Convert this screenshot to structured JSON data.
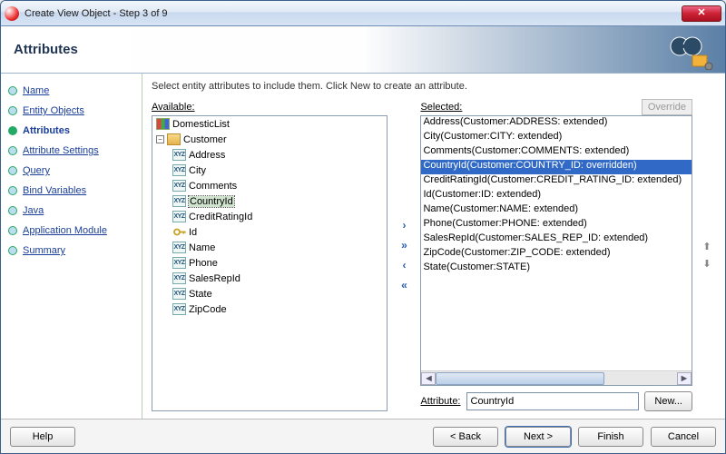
{
  "window": {
    "title": "Create View Object - Step 3 of 9",
    "close_glyph": "✕"
  },
  "banner": {
    "heading": "Attributes"
  },
  "steps": [
    {
      "label": "Name"
    },
    {
      "label": "Entity Objects"
    },
    {
      "label": "Attributes"
    },
    {
      "label": "Attribute Settings"
    },
    {
      "label": "Query"
    },
    {
      "label": "Bind Variables"
    },
    {
      "label": "Java"
    },
    {
      "label": "Application Module"
    },
    {
      "label": "Summary"
    }
  ],
  "instruction": "Select entity attributes to include them.  Click New to create an attribute.",
  "available": {
    "label": "Available:",
    "root": "DomesticList",
    "entity": "Customer",
    "attrs": [
      "Address",
      "City",
      "Comments",
      "CountryId",
      "CreditRatingId",
      "Id",
      "Name",
      "Phone",
      "SalesRepId",
      "State",
      "ZipCode"
    ],
    "selected_attr": "CountryId",
    "key_attr": "Id"
  },
  "selected": {
    "label": "Selected:",
    "override_label": "Override",
    "items": [
      "Address(Customer:ADDRESS: extended)",
      "City(Customer:CITY: extended)",
      "Comments(Customer:COMMENTS: extended)",
      "CountryId(Customer:COUNTRY_ID: overridden)",
      "CreditRatingId(Customer:CREDIT_RATING_ID: extended)",
      "Id(Customer:ID: extended)",
      "Name(Customer:NAME: extended)",
      "Phone(Customer:PHONE: extended)",
      "SalesRepId(Customer:SALES_REP_ID: extended)",
      "ZipCode(Customer:ZIP_CODE: extended)",
      "State(Customer:STATE)"
    ],
    "highlighted_index": 3
  },
  "attribute_row": {
    "label": "Attribute:",
    "value": "CountryId",
    "new_label": "New..."
  },
  "footer": {
    "help": "Help",
    "back": "< Back",
    "next": "Next >",
    "finish": "Finish",
    "cancel": "Cancel"
  },
  "shuttle": {
    "add": "›",
    "add_all": "»",
    "remove": "‹",
    "remove_all": "«"
  },
  "reorder": {
    "up": "⬆",
    "down": "⬇"
  }
}
